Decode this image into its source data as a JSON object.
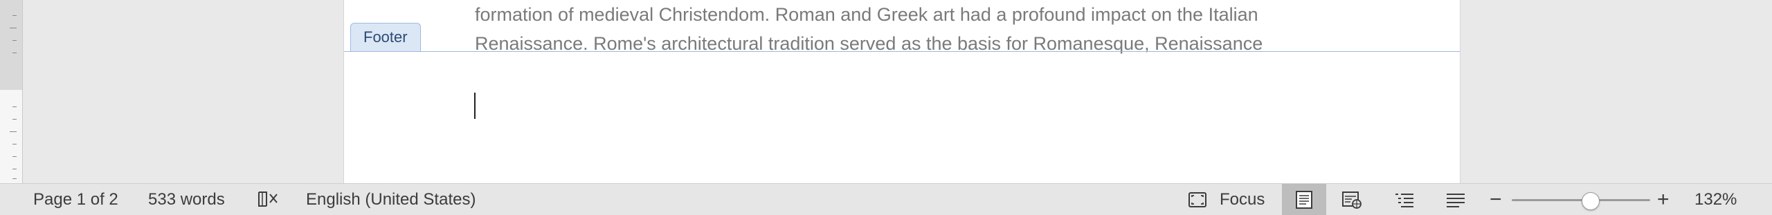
{
  "document": {
    "body_lines": [
      "formation of medieval Christendom. Roman and Greek art had a profound impact on the Italian",
      "Renaissance. Rome's architectural tradition served as the basis for Romanesque, Renaissance"
    ],
    "footer_tab_label": "Footer"
  },
  "statusbar": {
    "page_info": "Page 1 of 2",
    "word_count": "533 words",
    "language": "English (United States)",
    "focus_label": "Focus",
    "zoom_minus": "−",
    "zoom_plus": "+",
    "zoom_level": "132%",
    "zoom_fraction": 0.57,
    "views": [
      "print-layout-view",
      "web-layout-view",
      "outline-view",
      "draft-view"
    ],
    "active_view": "print-layout-view"
  },
  "colors": {
    "footer_border": "#9cb9df",
    "footer_tab_bg": "#dce7f6",
    "body_text": "#7a7a7a",
    "status_text": "#3c3c3c"
  }
}
